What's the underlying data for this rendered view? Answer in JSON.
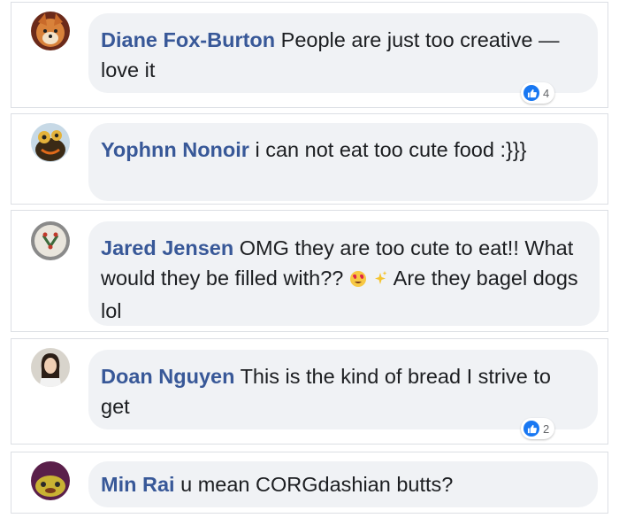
{
  "comments": [
    {
      "name": "Diane Fox-Burton",
      "text": "People are just too creative —love it",
      "reaction_icon": "like-icon",
      "reaction_count": "4"
    },
    {
      "name": "Yophnn Nonoir",
      "text": "i can not eat too cute food :}}}"
    },
    {
      "name": "Jared Jensen",
      "text_before": "OMG they are too cute to eat!! What would they be filled with??",
      "emojis": [
        "heart-eyes-emoji",
        "sparkles-emoji"
      ],
      "text_after": "Are they bagel dogs lol"
    },
    {
      "name": "Doan Nguyen",
      "text": "This is the kind of bread I strive to get",
      "reaction_icon": "like-icon",
      "reaction_count": "2"
    },
    {
      "name": "Min Rai",
      "text": "u mean CORGdashian butts?"
    }
  ],
  "colors": {
    "name": "#385898",
    "bubble": "#f0f2f5",
    "like": "#1877f2",
    "text": "#1c1e21"
  }
}
